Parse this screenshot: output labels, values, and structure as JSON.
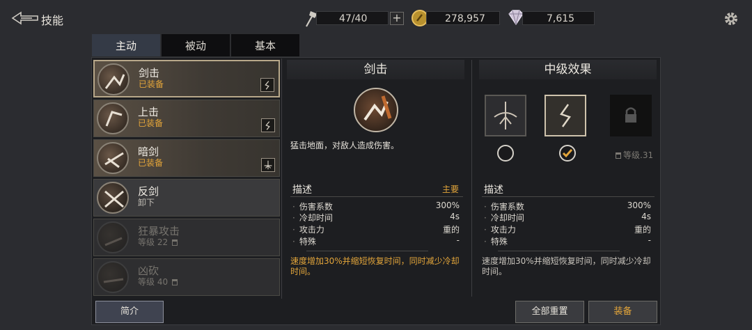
{
  "header": {
    "title": "技能",
    "stamina": "47/40",
    "gold": "278,957",
    "gems": "7,615"
  },
  "tabs": [
    {
      "label": "主动",
      "active": true
    },
    {
      "label": "被动",
      "active": false
    },
    {
      "label": "基本",
      "active": false
    }
  ],
  "skills": [
    {
      "name": "剑击",
      "status": "已装备",
      "state": "equipped",
      "icon": "sword-strike-icon"
    },
    {
      "name": "上击",
      "status": "已装备",
      "state": "equipped",
      "icon": "upper-strike-icon"
    },
    {
      "name": "暗剑",
      "status": "已装备",
      "state": "equipped",
      "icon": "dark-sword-icon"
    },
    {
      "name": "反剑",
      "status": "卸下",
      "state": "normal",
      "icon": "counter-sword-icon"
    },
    {
      "name": "狂暴攻击",
      "status": "等级 22",
      "state": "locked",
      "icon": "berserk-attack-icon"
    },
    {
      "name": "凶砍",
      "status": "等级 40",
      "state": "locked",
      "icon": "fierce-slash-icon"
    }
  ],
  "detail": {
    "name": "剑击",
    "description": "猛击地面，对敌人造成伤害。",
    "section_title": "描述",
    "section_tag": "主要",
    "stats": [
      {
        "label": "伤害系数",
        "value": "300%"
      },
      {
        "label": "冷却时间",
        "value": "4s"
      },
      {
        "label": "攻击力",
        "value": "重的"
      },
      {
        "label": "特殊",
        "value": "-"
      }
    ],
    "note": "速度增加30%并缩短恢复时间，同时减少冷却时间。"
  },
  "effects": {
    "title": "中级效果",
    "section_title": "描述",
    "stats": [
      {
        "label": "伤害系数",
        "value": "300%"
      },
      {
        "label": "冷却时间",
        "value": "4s"
      },
      {
        "label": "攻击力",
        "value": "重的"
      },
      {
        "label": "特殊",
        "value": "-"
      }
    ],
    "note": "速度增加30%并缩短恢复时间，同时减少冷却时间。",
    "lock_level": "等级.31"
  },
  "buttons": {
    "intro": "简介",
    "reset_all": "全部重置",
    "equip": "装备"
  },
  "colors": {
    "accent_gold": "#e3a53a",
    "panel_bg": "#1d1e21"
  }
}
